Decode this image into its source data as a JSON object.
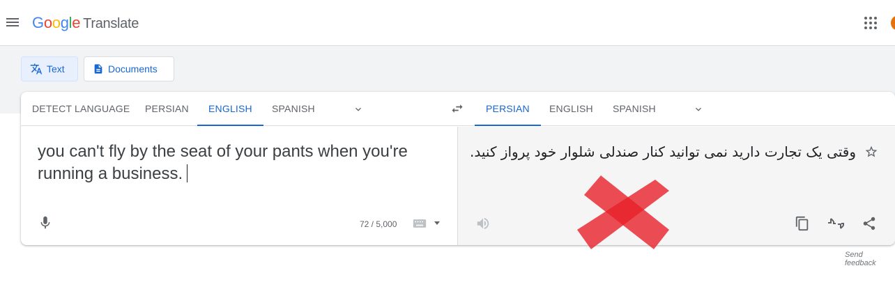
{
  "header": {
    "logo": {
      "g1": "G",
      "g2": "o",
      "g3": "o",
      "g4": "g",
      "g5": "l",
      "g6": "e"
    },
    "product": "Translate"
  },
  "modes": {
    "text": "Text",
    "documents": "Documents"
  },
  "source": {
    "languages": [
      "DETECT LANGUAGE",
      "PERSIAN",
      "ENGLISH",
      "SPANISH"
    ],
    "selected": "ENGLISH",
    "text": "you can't fly by the seat of your pants when you're running a business.",
    "char_count": "72 / 5,000"
  },
  "target": {
    "languages": [
      "PERSIAN",
      "ENGLISH",
      "SPANISH"
    ],
    "selected": "PERSIAN",
    "text": "وقتی یک تجارت دارید نمی توانید کنار صندلی شلوار خود پرواز کنید."
  },
  "footer": {
    "feedback": "Send feedback"
  },
  "colors": {
    "accent": "#1967d2",
    "overlay_x": "#e8202a"
  },
  "icons": [
    "menu-icon",
    "apps-icon",
    "translate-icon",
    "document-icon",
    "chevron-down-icon",
    "swap-icon",
    "mic-icon",
    "keyboard-icon",
    "speaker-icon",
    "star-icon",
    "copy-icon",
    "rate-icon",
    "share-icon"
  ]
}
